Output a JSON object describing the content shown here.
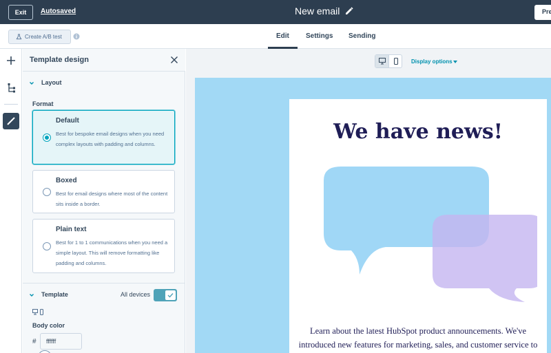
{
  "topbar": {
    "exit_label": "Exit",
    "autosaved_label": "Autosaved",
    "email_title": "New email",
    "preview_label": "Pre"
  },
  "subbar": {
    "ab_test_label": "Create A/B test",
    "tabs": [
      {
        "label": "Edit",
        "active": true
      },
      {
        "label": "Settings",
        "active": false
      },
      {
        "label": "Sending",
        "active": false
      }
    ]
  },
  "rail": {
    "icons": [
      "plus-icon",
      "tree-icon",
      "pencil-icon"
    ]
  },
  "panel": {
    "title": "Template design",
    "layout_section": "Layout",
    "format_label": "Format",
    "formats": [
      {
        "title": "Default",
        "desc": "Best for bespoke email designs when you need complex layouts with padding and columns.",
        "selected": true
      },
      {
        "title": "Boxed",
        "desc": "Best for email designs where most of the content sits inside a border.",
        "selected": false
      },
      {
        "title": "Plain text",
        "desc": "Best for 1 to 1 communications when you need a simple layout. This will remove formatting like padding and columns.",
        "selected": false
      }
    ],
    "template_section": "Template",
    "all_devices_label": "All devices",
    "all_devices_on": true,
    "body_color_label": "Body color",
    "body_color_hash": "#",
    "body_color_value": "ffffff"
  },
  "preview": {
    "display_options_label": "Display options",
    "headline": "We have news!",
    "body_lines": [
      "Learn about the latest HubSpot product announcements. We've",
      "introduced new features for marketing, sales, and customer service to"
    ]
  },
  "colors": {
    "topbar": "#2d3e50",
    "accent": "#00a4bd",
    "canvas": "#a2d9f5",
    "headline": "#1f1d56",
    "bubble_blue": "#8fd0f5",
    "bubble_purple": "#c4b5f0"
  }
}
